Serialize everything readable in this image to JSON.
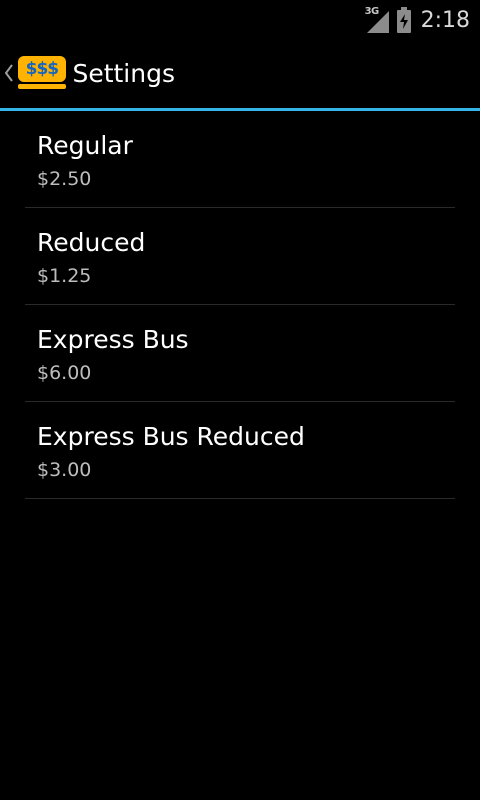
{
  "status_bar": {
    "network_type": "3G",
    "signal_icon": "signal-icon",
    "battery_icon": "battery-charging-icon",
    "time": "2:18"
  },
  "action_bar": {
    "up_icon": "chevron-left-icon",
    "app_icon_text": "$$$",
    "app_icon_color": "#ffb300",
    "app_icon_text_color": "#1565c0",
    "title": "Settings",
    "divider_color": "#33b5e5"
  },
  "fares": [
    {
      "name": "Regular",
      "price": "$2.50"
    },
    {
      "name": "Reduced",
      "price": "$1.25"
    },
    {
      "name": "Express Bus",
      "price": "$6.00"
    },
    {
      "name": "Express Bus Reduced",
      "price": "$3.00"
    }
  ]
}
